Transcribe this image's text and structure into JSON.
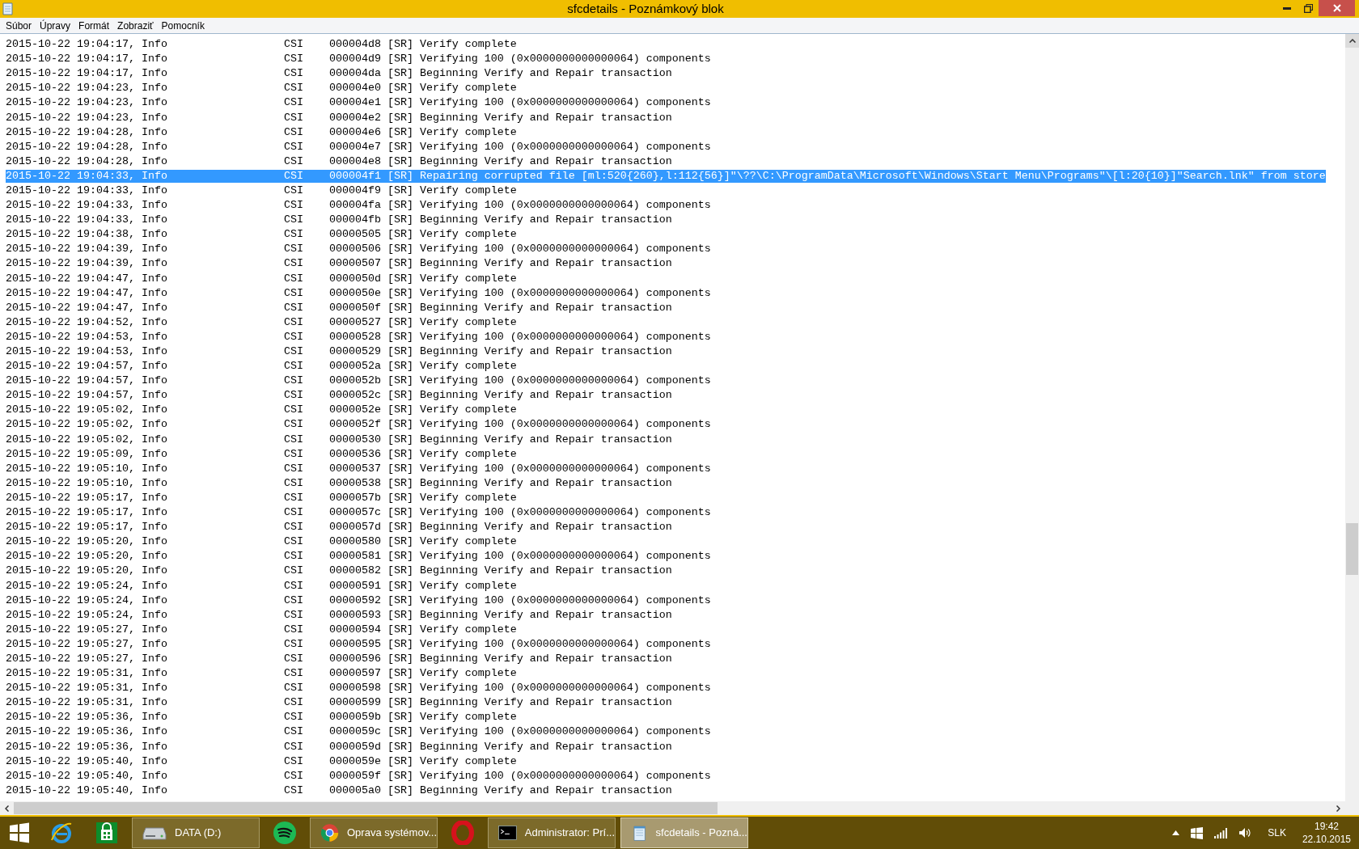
{
  "window": {
    "title": "sfcdetails - Poznámkový blok"
  },
  "menu": [
    "Súbor",
    "Úpravy",
    "Formát",
    "Zobraziť",
    "Pomocník"
  ],
  "lines": [
    {
      "text": "2015-10-22 19:04:17, Info                  CSI    000004d8 [SR] Verify complete",
      "selected": false
    },
    {
      "text": "2015-10-22 19:04:17, Info                  CSI    000004d9 [SR] Verifying 100 (0x0000000000000064) components",
      "selected": false
    },
    {
      "text": "2015-10-22 19:04:17, Info                  CSI    000004da [SR] Beginning Verify and Repair transaction",
      "selected": false
    },
    {
      "text": "2015-10-22 19:04:23, Info                  CSI    000004e0 [SR] Verify complete",
      "selected": false
    },
    {
      "text": "2015-10-22 19:04:23, Info                  CSI    000004e1 [SR] Verifying 100 (0x0000000000000064) components",
      "selected": false
    },
    {
      "text": "2015-10-22 19:04:23, Info                  CSI    000004e2 [SR] Beginning Verify and Repair transaction",
      "selected": false
    },
    {
      "text": "2015-10-22 19:04:28, Info                  CSI    000004e6 [SR] Verify complete",
      "selected": false
    },
    {
      "text": "2015-10-22 19:04:28, Info                  CSI    000004e7 [SR] Verifying 100 (0x0000000000000064) components",
      "selected": false
    },
    {
      "text": "2015-10-22 19:04:28, Info                  CSI    000004e8 [SR] Beginning Verify and Repair transaction",
      "selected": false
    },
    {
      "text": "2015-10-22 19:04:33, Info                  CSI    000004f1 [SR] Repairing corrupted file [ml:520{260},l:112{56}]\"\\??\\C:\\ProgramData\\Microsoft\\Windows\\Start Menu\\Programs\"\\[l:20{10}]\"Search.lnk\" from store",
      "selected": true
    },
    {
      "text": "2015-10-22 19:04:33, Info                  CSI    000004f9 [SR] Verify complete",
      "selected": false
    },
    {
      "text": "2015-10-22 19:04:33, Info                  CSI    000004fa [SR] Verifying 100 (0x0000000000000064) components",
      "selected": false
    },
    {
      "text": "2015-10-22 19:04:33, Info                  CSI    000004fb [SR] Beginning Verify and Repair transaction",
      "selected": false
    },
    {
      "text": "2015-10-22 19:04:38, Info                  CSI    00000505 [SR] Verify complete",
      "selected": false
    },
    {
      "text": "2015-10-22 19:04:39, Info                  CSI    00000506 [SR] Verifying 100 (0x0000000000000064) components",
      "selected": false
    },
    {
      "text": "2015-10-22 19:04:39, Info                  CSI    00000507 [SR] Beginning Verify and Repair transaction",
      "selected": false
    },
    {
      "text": "2015-10-22 19:04:47, Info                  CSI    0000050d [SR] Verify complete",
      "selected": false
    },
    {
      "text": "2015-10-22 19:04:47, Info                  CSI    0000050e [SR] Verifying 100 (0x0000000000000064) components",
      "selected": false
    },
    {
      "text": "2015-10-22 19:04:47, Info                  CSI    0000050f [SR] Beginning Verify and Repair transaction",
      "selected": false
    },
    {
      "text": "2015-10-22 19:04:52, Info                  CSI    00000527 [SR] Verify complete",
      "selected": false
    },
    {
      "text": "2015-10-22 19:04:53, Info                  CSI    00000528 [SR] Verifying 100 (0x0000000000000064) components",
      "selected": false
    },
    {
      "text": "2015-10-22 19:04:53, Info                  CSI    00000529 [SR] Beginning Verify and Repair transaction",
      "selected": false
    },
    {
      "text": "2015-10-22 19:04:57, Info                  CSI    0000052a [SR] Verify complete",
      "selected": false
    },
    {
      "text": "2015-10-22 19:04:57, Info                  CSI    0000052b [SR] Verifying 100 (0x0000000000000064) components",
      "selected": false
    },
    {
      "text": "2015-10-22 19:04:57, Info                  CSI    0000052c [SR] Beginning Verify and Repair transaction",
      "selected": false
    },
    {
      "text": "2015-10-22 19:05:02, Info                  CSI    0000052e [SR] Verify complete",
      "selected": false
    },
    {
      "text": "2015-10-22 19:05:02, Info                  CSI    0000052f [SR] Verifying 100 (0x0000000000000064) components",
      "selected": false
    },
    {
      "text": "2015-10-22 19:05:02, Info                  CSI    00000530 [SR] Beginning Verify and Repair transaction",
      "selected": false
    },
    {
      "text": "2015-10-22 19:05:09, Info                  CSI    00000536 [SR] Verify complete",
      "selected": false
    },
    {
      "text": "2015-10-22 19:05:10, Info                  CSI    00000537 [SR] Verifying 100 (0x0000000000000064) components",
      "selected": false
    },
    {
      "text": "2015-10-22 19:05:10, Info                  CSI    00000538 [SR] Beginning Verify and Repair transaction",
      "selected": false
    },
    {
      "text": "2015-10-22 19:05:17, Info                  CSI    0000057b [SR] Verify complete",
      "selected": false
    },
    {
      "text": "2015-10-22 19:05:17, Info                  CSI    0000057c [SR] Verifying 100 (0x0000000000000064) components",
      "selected": false
    },
    {
      "text": "2015-10-22 19:05:17, Info                  CSI    0000057d [SR] Beginning Verify and Repair transaction",
      "selected": false
    },
    {
      "text": "2015-10-22 19:05:20, Info                  CSI    00000580 [SR] Verify complete",
      "selected": false
    },
    {
      "text": "2015-10-22 19:05:20, Info                  CSI    00000581 [SR] Verifying 100 (0x0000000000000064) components",
      "selected": false
    },
    {
      "text": "2015-10-22 19:05:20, Info                  CSI    00000582 [SR] Beginning Verify and Repair transaction",
      "selected": false
    },
    {
      "text": "2015-10-22 19:05:24, Info                  CSI    00000591 [SR] Verify complete",
      "selected": false
    },
    {
      "text": "2015-10-22 19:05:24, Info                  CSI    00000592 [SR] Verifying 100 (0x0000000000000064) components",
      "selected": false
    },
    {
      "text": "2015-10-22 19:05:24, Info                  CSI    00000593 [SR] Beginning Verify and Repair transaction",
      "selected": false
    },
    {
      "text": "2015-10-22 19:05:27, Info                  CSI    00000594 [SR] Verify complete",
      "selected": false
    },
    {
      "text": "2015-10-22 19:05:27, Info                  CSI    00000595 [SR] Verifying 100 (0x0000000000000064) components",
      "selected": false
    },
    {
      "text": "2015-10-22 19:05:27, Info                  CSI    00000596 [SR] Beginning Verify and Repair transaction",
      "selected": false
    },
    {
      "text": "2015-10-22 19:05:31, Info                  CSI    00000597 [SR] Verify complete",
      "selected": false
    },
    {
      "text": "2015-10-22 19:05:31, Info                  CSI    00000598 [SR] Verifying 100 (0x0000000000000064) components",
      "selected": false
    },
    {
      "text": "2015-10-22 19:05:31, Info                  CSI    00000599 [SR] Beginning Verify and Repair transaction",
      "selected": false
    },
    {
      "text": "2015-10-22 19:05:36, Info                  CSI    0000059b [SR] Verify complete",
      "selected": false
    },
    {
      "text": "2015-10-22 19:05:36, Info                  CSI    0000059c [SR] Verifying 100 (0x0000000000000064) components",
      "selected": false
    },
    {
      "text": "2015-10-22 19:05:36, Info                  CSI    0000059d [SR] Beginning Verify and Repair transaction",
      "selected": false
    },
    {
      "text": "2015-10-22 19:05:40, Info                  CSI    0000059e [SR] Verify complete",
      "selected": false
    },
    {
      "text": "2015-10-22 19:05:40, Info                  CSI    0000059f [SR] Verifying 100 (0x0000000000000064) components",
      "selected": false
    },
    {
      "text": "2015-10-22 19:05:40, Info                  CSI    000005a0 [SR] Beginning Verify and Repair transaction",
      "selected": false
    }
  ],
  "taskbar": {
    "items": [
      {
        "kind": "start"
      },
      {
        "kind": "browser-e"
      },
      {
        "kind": "store"
      },
      {
        "kind": "drive",
        "label": "DATA (D:)",
        "selected": false
      },
      {
        "kind": "music"
      },
      {
        "kind": "chrome",
        "label": "Oprava systémov...",
        "selected": false
      },
      {
        "kind": "opera"
      },
      {
        "kind": "console",
        "label": "Administrator: Prí...",
        "selected": false
      },
      {
        "kind": "notepad",
        "label": "sfcdetails - Pozná...",
        "selected": true
      }
    ],
    "language": "SLK",
    "time": "19:42",
    "date": "22.10.2015"
  }
}
